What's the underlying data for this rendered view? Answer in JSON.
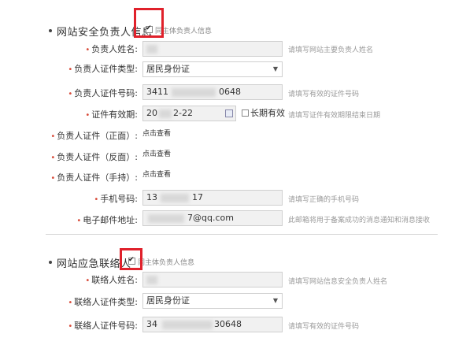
{
  "section1": {
    "title": "网站安全负责人信息",
    "same_as_label": "同主体负责人信息",
    "same_as_checked": true,
    "fields": {
      "name": {
        "label": "负责人姓名:",
        "value": "",
        "hint": "请填写网站主要负责人姓名"
      },
      "id_type": {
        "label": "负责人证件类型:",
        "value": "居民身份证"
      },
      "id_number": {
        "label": "负责人证件号码:",
        "value_prefix": "3411",
        "value_suffix": "0648",
        "hint": "请填写有效的证件号码"
      },
      "id_validity": {
        "label": "证件有效期:",
        "value_prefix": "20",
        "value_suffix": "2-22",
        "long_term_label": "长期有效",
        "hint": "请填写证件有效期限结束日期"
      },
      "id_front": {
        "label": "负责人证件（正面）:",
        "link": "点击查看"
      },
      "id_back": {
        "label": "负责人证件（反面）:",
        "link": "点击查看"
      },
      "id_handheld": {
        "label": "负责人证件（手持）:",
        "link": "点击查看"
      },
      "mobile": {
        "label": "手机号码:",
        "value_prefix": "13",
        "value_suffix": "17",
        "hint": "请填写正确的手机号码"
      },
      "email": {
        "label": "电子邮件地址:",
        "value_suffix": "7@qq.com",
        "hint": "此邮箱将用于备案成功的消息通知和消息接收"
      }
    }
  },
  "section2": {
    "title": "网站应急联络人",
    "same_as_label": "同主体负责人信息",
    "same_as_checked": true,
    "fields": {
      "name": {
        "label": "联络人姓名:",
        "value": "",
        "hint": "请填写网站信息安全负责人姓名"
      },
      "id_type": {
        "label": "联络人证件类型:",
        "value": "居民身份证"
      },
      "id_number": {
        "label": "联络人证件号码:",
        "value_prefix": "34",
        "value_suffix": "30648",
        "hint": "请填写有效的证件号码"
      }
    }
  },
  "colors": {
    "highlight_box": "#e0212b",
    "required_star": "#d84b3a",
    "input_bg": "#f1f1f1"
  },
  "icons": {
    "calendar": "calendar-icon",
    "dropdown": "chevron-down-icon",
    "checkmark": "check-icon"
  }
}
